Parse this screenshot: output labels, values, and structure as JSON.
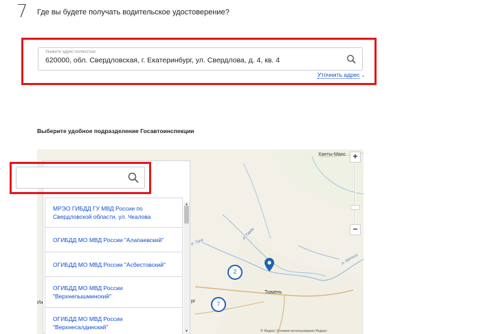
{
  "step": {
    "number": "7",
    "question": "Где вы будете получать водительское удостоверение?"
  },
  "address": {
    "caption": "Укажите адрес полностью",
    "value": "620000, обл. Свердловская, г. Екатеринбург, ул. Свердлова, д. 4, кв. 4",
    "refine_label": "Уточнить адрес",
    "refine_chevron": "⌄"
  },
  "division": {
    "title": "Выберите удобное подразделение Госавтоинспекции"
  },
  "map": {
    "cities": {
      "khanty": "Ханты-Манс",
      "tyumen": "Тюмень",
      "left_edge": "Иж",
      "rg": "рг"
    },
    "rivers": {
      "tura": "р. Тура",
      "tavda": "р. Тавда",
      "irtysh": "р. Иртыш"
    },
    "clusters": {
      "a": "2",
      "b": "7"
    },
    "zoom_in": "+",
    "zoom_out": "−",
    "footer": "© Яндекс Условия использования  Яндекс"
  },
  "divisions": [
    {
      "line1": "МРЭО ГИБДД ГУ МВД России по",
      "line2": "Свердловской области, ул. Чкалова"
    },
    {
      "line1": "ОГИБДД МО МВД России \"Алапаевский\"",
      "line2": ""
    },
    {
      "line1": "ОГИБДД МО МВД России \"Асбестовский\"",
      "line2": ""
    },
    {
      "line1": "ОГИБДД МО МВД России",
      "line2": "\"Верхнепышминский\""
    },
    {
      "line1": "ОГИБДД МО МВД России",
      "line2": "\"Верхнесалдинский\""
    }
  ],
  "colors": {
    "accent": "#0d4cd3",
    "highlight": "#e3161b",
    "marker": "#1f62b4"
  }
}
